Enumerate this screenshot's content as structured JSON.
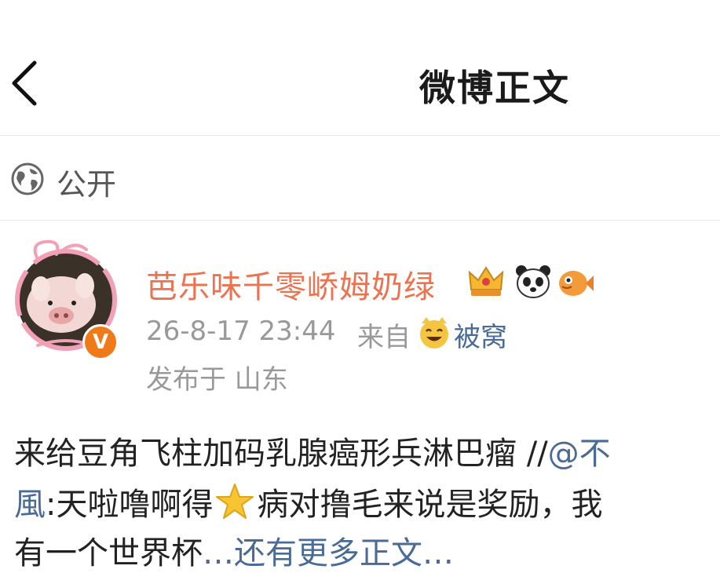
{
  "header": {
    "title": "微博正文",
    "back_icon": "chevron-left-icon"
  },
  "privacy": {
    "label": "公开",
    "icon": "globe-icon"
  },
  "post": {
    "username": "芭乐味千零峤姆奶绿",
    "badges": [
      "crown-icon",
      "panda-icon",
      "fish-icon"
    ],
    "timestamp": "26-8-17 23:44",
    "from_label": "来自",
    "source": "被窝",
    "location": "发布于 山东",
    "verified_badge": "V",
    "line1_text": "来给豆角飞柱加码乳腺癌形兵淋巴瘤 //",
    "line1_mention": "@不",
    "line2_mention": "風",
    "line2_text_a": ":天啦噜啊得",
    "line2_text_b": "病对撸毛来说是奖励，我",
    "line3_text": "有一个世界杯",
    "line3_mention": "…还有更多正文…"
  },
  "colors": {
    "username": "#eb7350",
    "link": "#4a6b96",
    "muted": "#999999",
    "verified": "#f07a1a"
  }
}
